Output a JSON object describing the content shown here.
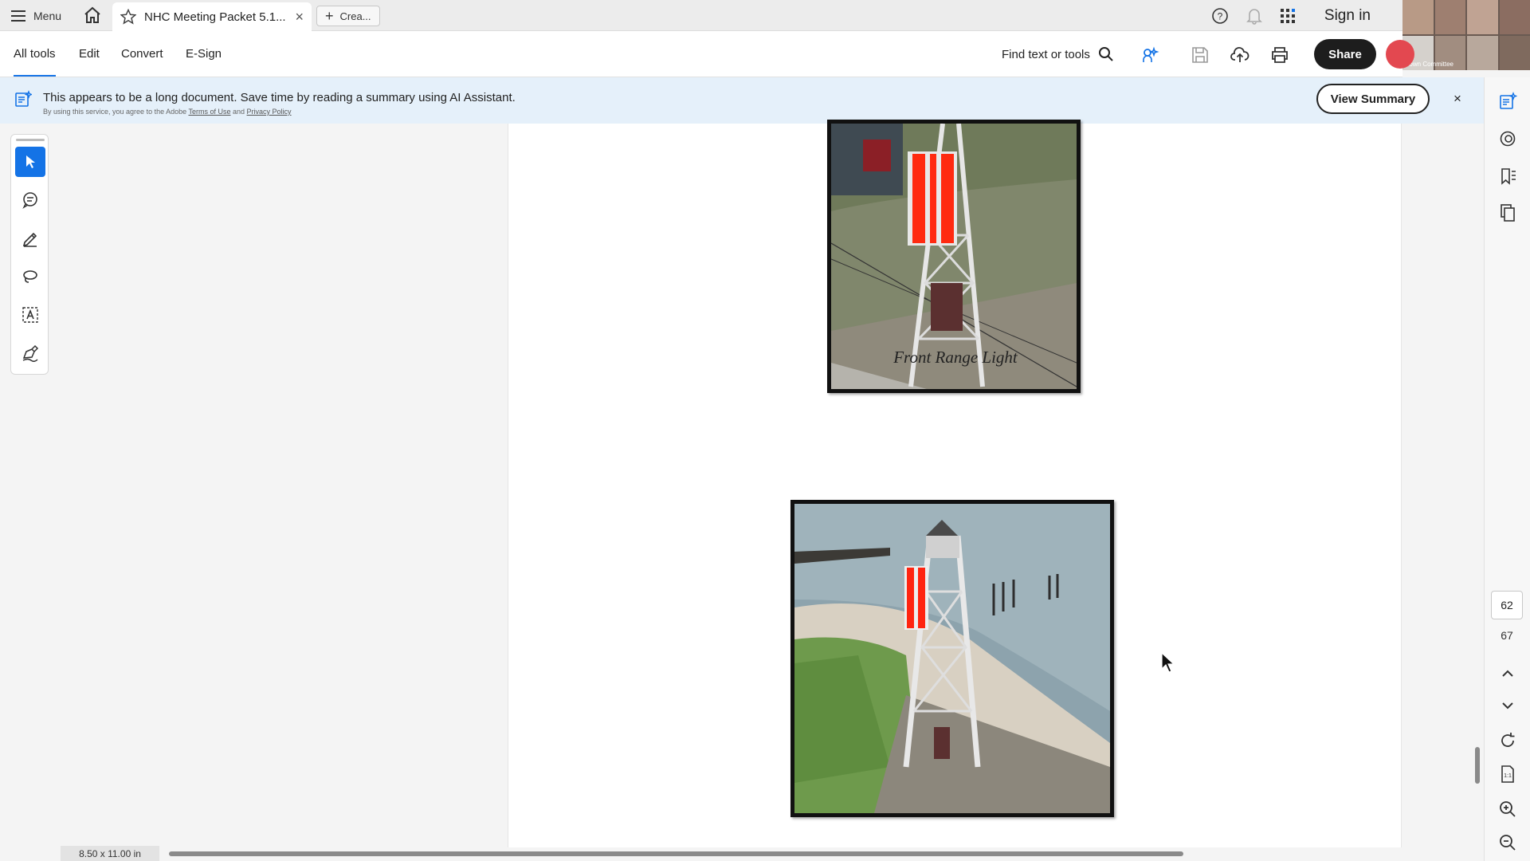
{
  "tabbar": {
    "menu_label": "Menu",
    "tab_title": "NHC Meeting Packet 5.1...",
    "new_tab_label": "Crea...",
    "sign_in": "Sign in",
    "video_label": "Town Committee"
  },
  "toolbar": {
    "all_tools": "All tools",
    "edit": "Edit",
    "convert": "Convert",
    "esign": "E-Sign",
    "find": "Find text or tools",
    "share": "Share"
  },
  "banner": {
    "message": "This appears to be a long document. Save time by reading a summary using AI Assistant.",
    "sub_prefix": "By using this service, you agree to the Adobe",
    "terms": "Terms of Use",
    "and": "and",
    "privacy": "Privacy Policy",
    "button": "View Summary",
    "close": "×"
  },
  "document": {
    "caption": "Front Range Light"
  },
  "navigation": {
    "current_page": "62",
    "total_pages": "67"
  },
  "status": {
    "page_size": "8.50 x 11.00 in"
  },
  "colors": {
    "accent": "#1473e6",
    "banner_bg": "#e5f0fa",
    "share_bg": "#1d1d1d"
  }
}
